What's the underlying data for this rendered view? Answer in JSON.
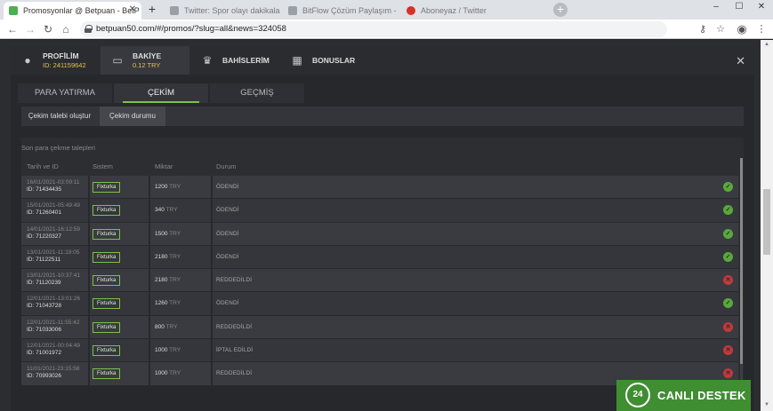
{
  "browser": {
    "tabs": [
      {
        "title": "Promosyonlar @ Betpuan - BetP",
        "favicon_color": "#4caf50",
        "active": true
      },
      {
        "title": "Twitter: Spor olayı dakikalarını",
        "favicon_color": "#888888",
        "active": false
      },
      {
        "title": "BitFlow Çözüm Paylaşım - BitC",
        "favicon_color": "#888888",
        "active": false
      },
      {
        "title": "Aboneyaz / Twitter",
        "favicon_color": "#d93025",
        "active": false
      }
    ],
    "url": "betpuan50.com/#/promos/?slug=all&news=324058",
    "window_controls": {
      "minimize": "–",
      "maximize": "☐",
      "close": "✕"
    }
  },
  "header": {
    "tabs": [
      {
        "title": "PROFİLİM",
        "sub": "ID: 241159642",
        "icon": "user-icon"
      },
      {
        "title": "BAKİYE",
        "sub": "0.12 TRY",
        "icon": "wallet-icon"
      },
      {
        "title": "BAHİSLERİM",
        "sub": "",
        "icon": "trophy-icon"
      },
      {
        "title": "BONUSLAR",
        "sub": "",
        "icon": "gift-icon"
      }
    ],
    "close_label": "✕"
  },
  "subtabs": [
    "PARA YATIRMA",
    "ÇEKİM",
    "GEÇMİŞ"
  ],
  "actions": [
    "Çekim talebi oluştur",
    "Çekim durumu"
  ],
  "table": {
    "title": "Son para çekme talepleri",
    "columns": [
      "Tarih ve ID",
      "Sistem",
      "Miktar",
      "Durum"
    ],
    "rows": [
      {
        "date": "16/01/2021-03:09:11",
        "id": "ID: 71434435",
        "system": "Fixturka",
        "amount": "1200",
        "currency": "TRY",
        "status": "ÖDENDİ",
        "ok": true
      },
      {
        "date": "15/01/2021-05:49:49",
        "id": "ID: 71260401",
        "system": "Fixturka",
        "amount": "340",
        "currency": "TRY",
        "status": "ÖDENDİ",
        "ok": true
      },
      {
        "date": "14/01/2021-16:12:59",
        "id": "ID: 71220327",
        "system": "Fixturka",
        "amount": "1500",
        "currency": "TRY",
        "status": "ÖDENDİ",
        "ok": true
      },
      {
        "date": "13/01/2021-11:19:05",
        "id": "ID: 71122511",
        "system": "Fixturka",
        "amount": "2180",
        "currency": "TRY",
        "status": "ÖDENDİ",
        "ok": true
      },
      {
        "date": "13/01/2021-10:37:41",
        "id": "ID: 71120239",
        "system": "Fixturka",
        "amount": "2180",
        "currency": "TRY",
        "status": "REDDEDİLDİ",
        "ok": false
      },
      {
        "date": "12/01/2021-13:01:26",
        "id": "ID: 71043728",
        "system": "Fixturka",
        "amount": "1260",
        "currency": "TRY",
        "status": "ÖDENDİ",
        "ok": true
      },
      {
        "date": "12/01/2021-11:55:42",
        "id": "ID: 71033006",
        "system": "Fixturka",
        "amount": "800",
        "currency": "TRY",
        "status": "REDDEDİLDİ",
        "ok": false
      },
      {
        "date": "12/01/2021-00:04:49",
        "id": "ID: 71001972",
        "system": "Fixturka",
        "amount": "1000",
        "currency": "TRY",
        "status": "İPTAL EDİLDİ",
        "ok": false
      },
      {
        "date": "11/01/2021-23:15:58",
        "id": "ID: 70993026",
        "system": "Fixturka",
        "amount": "1000",
        "currency": "TRY",
        "status": "REDDEDİLDİ",
        "ok": false
      }
    ]
  },
  "support": {
    "badge": "24",
    "label": "CANLI DESTEK"
  },
  "colors": {
    "accent_green": "#7fbf4d",
    "ok_green": "#5aa83c",
    "reject_red": "#c0393b",
    "balance_yellow": "#e6c440"
  }
}
